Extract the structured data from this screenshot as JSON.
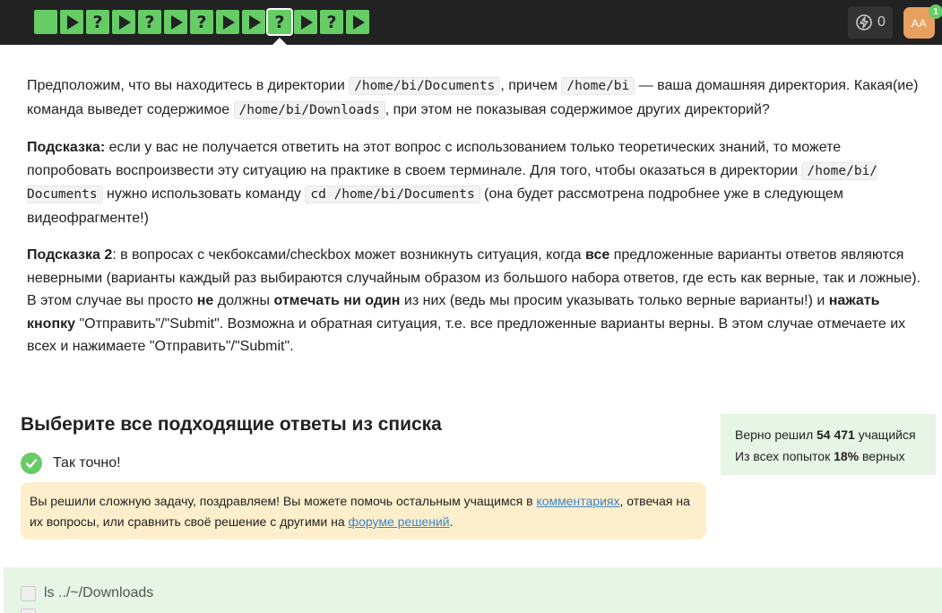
{
  "steps": [
    {
      "kind": "blank"
    },
    {
      "kind": "play"
    },
    {
      "kind": "question",
      "label": "?"
    },
    {
      "kind": "play"
    },
    {
      "kind": "question",
      "label": "?"
    },
    {
      "kind": "play"
    },
    {
      "kind": "question",
      "label": "?"
    },
    {
      "kind": "play"
    },
    {
      "kind": "play"
    },
    {
      "kind": "question",
      "label": "?",
      "current": true
    },
    {
      "kind": "play"
    },
    {
      "kind": "question",
      "label": "?"
    },
    {
      "kind": "play"
    }
  ],
  "header": {
    "energy_count": "0",
    "avatar_initials": "AA",
    "notification_count": "1"
  },
  "question": {
    "p1": {
      "t1": "Предположим, что вы находитесь в директории ",
      "c1": "/home/bi/Documents",
      "t2": ", причем ",
      "c2": "/home/bi",
      "t3": " — ваша домашняя директория. Какая(ие) команда выведет содержимое ",
      "c3": "/home/bi/Downloads",
      "t4": ", при этом не показывая содержимое других директорий?"
    },
    "p2": {
      "b1": "Подсказка:",
      "t1": " если у вас не получается ответить на этот вопрос с использованием только теоретических знаний, то можете попробовать воспроизвести эту ситуацию на практике в своем терминале. Для того, чтобы оказаться в директории ",
      "c1": "/home/bi/ Documents",
      "t2": " нужно использовать команду ",
      "c2": "cd /home/bi/Documents",
      "t3": " (она будет рассмотрена подробнее уже в следующем видеофрагменте!)"
    },
    "p3": {
      "b1": "Подсказка 2",
      "t1": ": в вопросах с чекбоксами/checkbox может возникнуть ситуация, когда ",
      "b2": "все",
      "t2": " предложенные варианты ответов являются неверными (варианты каждый раз выбираются случайным образом из большого набора ответов, где есть как верные, так и ложные). В этом случае вы просто ",
      "b3": "не",
      "t3": " должны ",
      "b4": "отмечать ни один",
      "t4": " из них (ведь мы просим указывать только верные варианты!) и ",
      "b5": "нажать кнопку",
      "t5": " \"Отправить\"/\"Submit\". Возможна и обратная ситуация, т.е. все предложенные варианты верны. В этом случае отмечаете их всех и нажимаете \"Отправить\"/\"Submit\"."
    }
  },
  "quiz": {
    "title": "Выберите все подходящие ответы из списка",
    "result_text": "Так точно!",
    "hint": {
      "t1": "Вы решили сложную задачу, поздравляем! Вы можете помочь остальным учащимся в ",
      "link1": "комментариях",
      "t2": ", отвечая на их вопросы, или сравнить своё решение с другими на ",
      "link2": "форуме решений",
      "t3": "."
    },
    "options": [
      {
        "label": "ls ../~/Downloads",
        "checked": false
      }
    ]
  },
  "stats": {
    "solved_prefix": "Верно решил ",
    "solved_count": "54 471",
    "solved_suffix": " учащийся",
    "attempts_prefix": "Из всех попыток ",
    "attempts_pct": "18%",
    "attempts_suffix": " верных"
  },
  "colors": {
    "step_green": "#66cc66",
    "topbar": "#222222",
    "hint_bg": "#feefcc",
    "stats_bg": "#e6f5e6",
    "link": "#3f83c4",
    "avatar": "#e8a060"
  }
}
